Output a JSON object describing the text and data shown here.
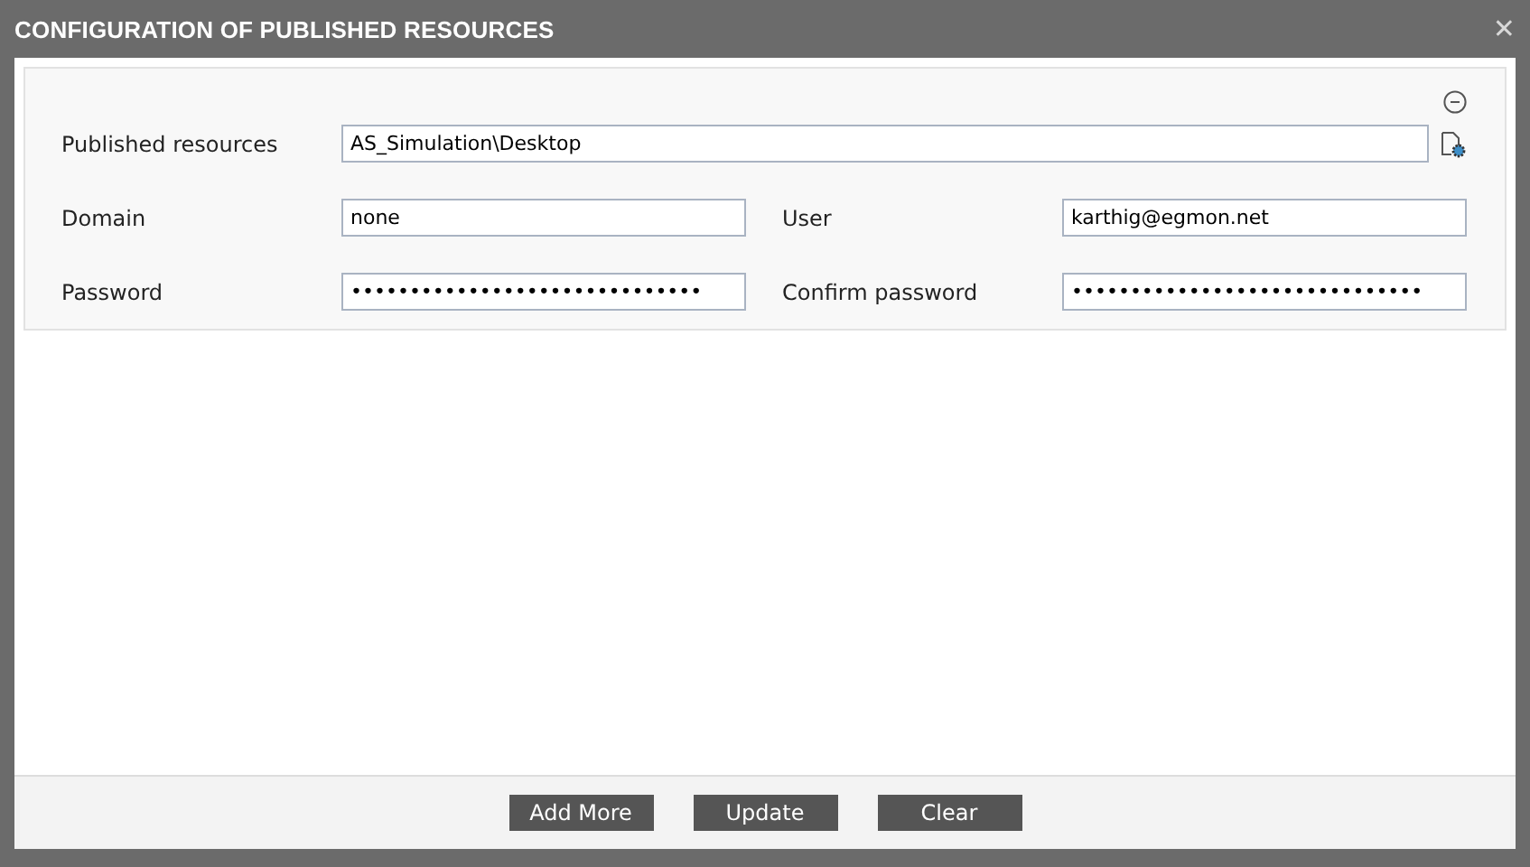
{
  "window": {
    "title": "CONFIGURATION OF PUBLISHED RESOURCES",
    "close": "✕"
  },
  "section": {
    "collapsed": false
  },
  "published_resources": {
    "label": "Published resources",
    "value": "AS_Simulation\\Desktop"
  },
  "fields": [
    {
      "label": "Domain",
      "value": "none"
    },
    {
      "label": "User",
      "value": "karthig@egmon.net"
    },
    {
      "label": "Password",
      "value": "••••••••••••••••••••••••••••••"
    },
    {
      "label": "Confirm password",
      "value": "••••••••••••••••••••••••••••••"
    }
  ],
  "buttons": [
    "Add More",
    "Update",
    "Clear"
  ]
}
